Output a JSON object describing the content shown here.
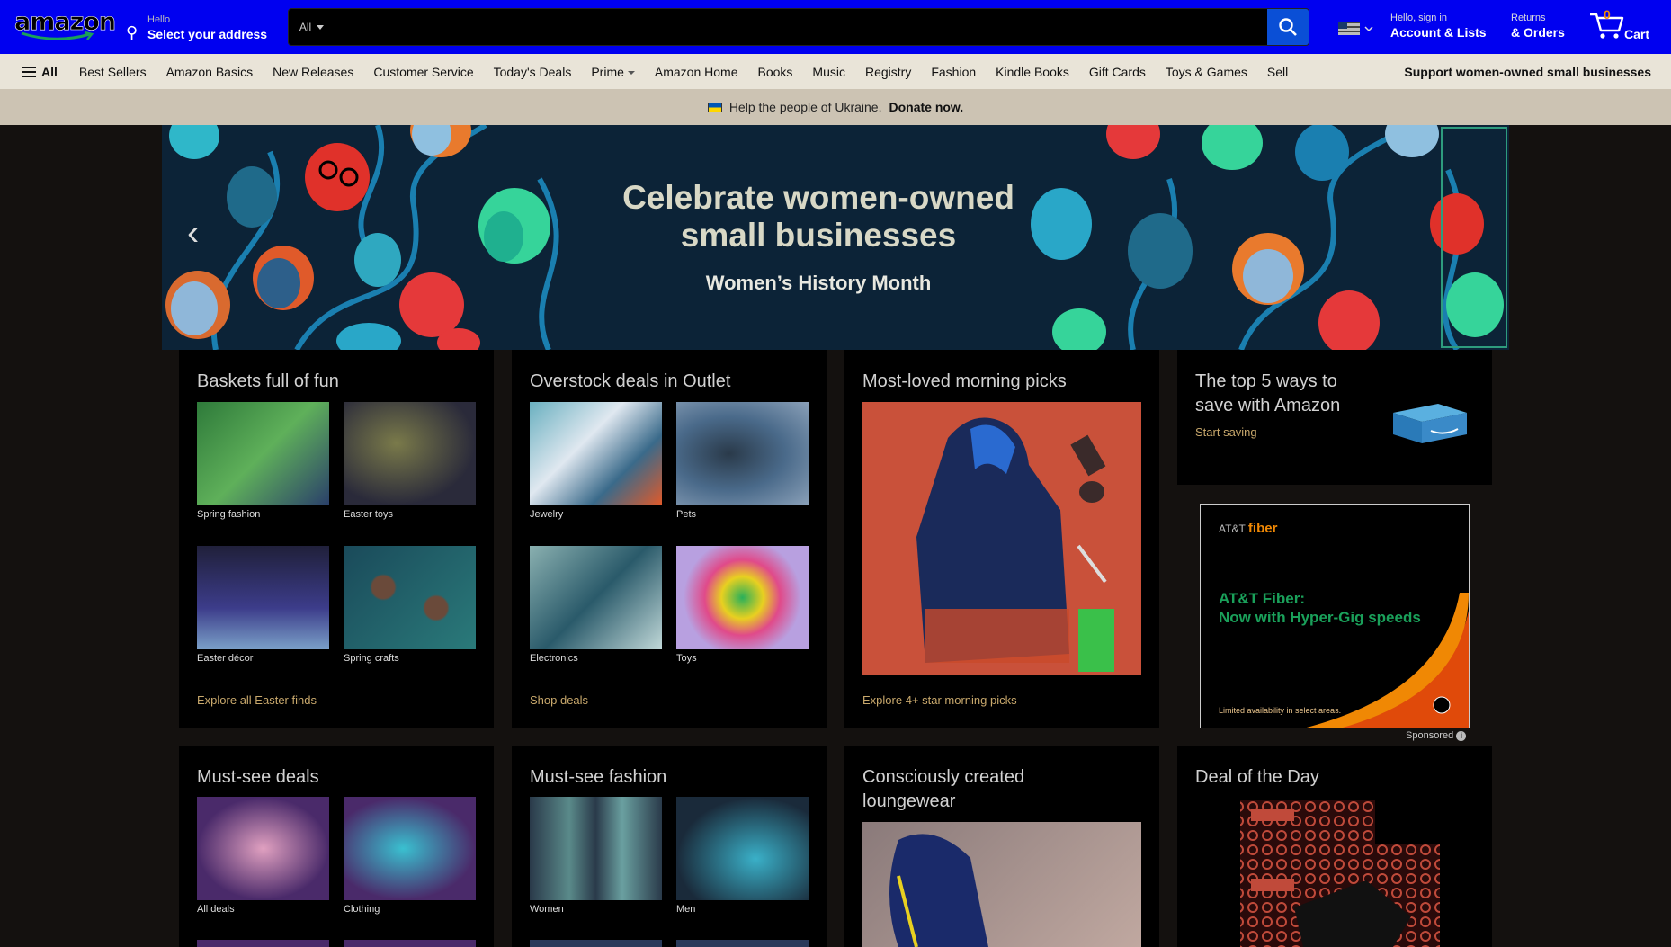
{
  "header": {
    "logo_text": "amazon",
    "deliver_line1": "Hello",
    "deliver_line2": "Select your address",
    "search": {
      "category": "All",
      "placeholder": ""
    },
    "account_line1": "Hello, sign in",
    "account_line2": "Account & Lists",
    "orders_line1": "Returns",
    "orders_line2": "& Orders",
    "cart_count": "0",
    "cart_label": "Cart"
  },
  "nav": {
    "all_label": "All",
    "links": [
      "Best Sellers",
      "Amazon Basics",
      "New Releases",
      "Customer Service",
      "Today's Deals",
      "Prime",
      "Amazon Home",
      "Books",
      "Music",
      "Registry",
      "Fashion",
      "Kindle Books",
      "Gift Cards",
      "Toys & Games",
      "Sell"
    ],
    "promo": "Support women-owned small businesses"
  },
  "notice": {
    "text": "Help the people of Ukraine.",
    "link": "Donate now."
  },
  "hero": {
    "title_line1": "Celebrate women-owned",
    "title_line2": "small businesses",
    "subtitle": "Women’s History Month"
  },
  "cards": {
    "easter": {
      "title": "Baskets full of fun",
      "tiles": [
        "Spring fashion",
        "Easter toys",
        "Easter décor",
        "Spring crafts"
      ],
      "link": "Explore all Easter finds"
    },
    "outlet": {
      "title": "Overstock deals in Outlet",
      "tiles": [
        "Jewelry",
        "Pets",
        "Electronics",
        "Toys"
      ],
      "link": "Shop deals"
    },
    "morning": {
      "title": "Most-loved morning picks",
      "link": "Explore 4+ star morning picks"
    },
    "save": {
      "title_line1": "The top 5 ways to",
      "title_line2": "save with Amazon",
      "link": "Start saving"
    },
    "deals": {
      "title": "Must-see deals",
      "tiles": [
        "All deals",
        "Clothing"
      ]
    },
    "fashion": {
      "title": "Must-see fashion",
      "tiles": [
        "Women",
        "Men"
      ]
    },
    "lounge": {
      "title_line1": "Consciously created",
      "title_line2": "loungewear"
    },
    "dotd": {
      "title": "Deal of the Day"
    }
  },
  "ad": {
    "brand_prefix": "AT&T",
    "brand_name": "fiber",
    "headline_line1": "AT&T Fiber:",
    "headline_line2": "Now with Hyper-Gig speeds",
    "fine_print": "Limited availability in select areas.",
    "sponsored": "Sponsored"
  },
  "colors": {
    "header_bg": "#0000f0",
    "nav_bg": "#e9e4d8",
    "notice_bg": "#ccc3b3",
    "page_bg": "#14110f",
    "link_gold": "#c8a86c",
    "search_button": "#0a4fd6"
  }
}
